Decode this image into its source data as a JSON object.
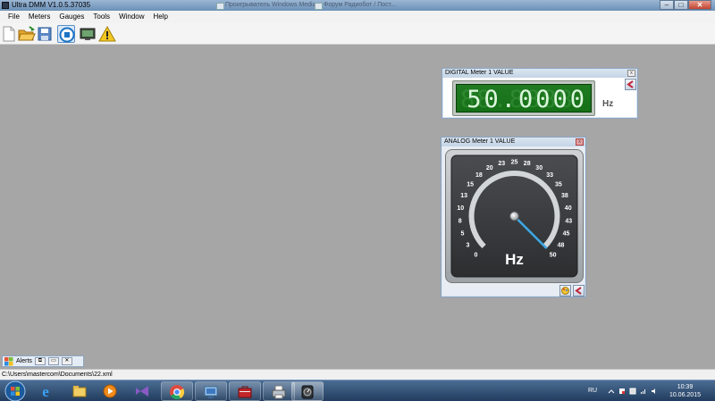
{
  "window": {
    "title": "Ultra DMM V1.0.5.37035",
    "background_tabs": [
      "Проигрыватель Windows Media",
      "Форум Радиобот / Пост..."
    ],
    "minimize_glyph": "–",
    "maximize_glyph": "□",
    "close_glyph": "✕"
  },
  "menu": [
    "File",
    "Meters",
    "Gauges",
    "Tools",
    "Window",
    "Help"
  ],
  "toolbar": {
    "buttons": [
      "new-file-icon",
      "open-folder-icon",
      "save-icon",
      "stop-icon",
      "monitor-icon",
      "warning-icon"
    ]
  },
  "digital_meter": {
    "title": "DIGITAL Meter 1 VALUE",
    "ghost_digits": "88.8888",
    "value": "50.0000",
    "unit": "Hz",
    "close_glyph": "x"
  },
  "analog_meter": {
    "title": "ANALOG Meter 1 VALUE",
    "unit": "Hz",
    "min": 0,
    "max": 50,
    "value": 50,
    "ticks": [
      "0",
      "3",
      "5",
      "8",
      "10",
      "13",
      "15",
      "18",
      "20",
      "23",
      "25",
      "28",
      "30",
      "33",
      "35",
      "38",
      "40",
      "43",
      "45",
      "48",
      "50"
    ],
    "close_glyph": "x"
  },
  "alerts_tab": {
    "label": "Alerts",
    "btn1": "⧉",
    "btn2": "▭",
    "btn3": "✕"
  },
  "statusbar": {
    "path": "C:\\Users\\mastercom\\Documents\\22.xml"
  },
  "taskbar": {
    "apps": [
      "ie-icon",
      "explorer-icon",
      "media-player-icon",
      "visual-studio-icon",
      "chrome-icon",
      "remote-desktop-icon",
      "briefcase-icon",
      "printer-icon",
      "meter-app-icon"
    ],
    "language": "RU",
    "time": "10:39",
    "date": "10.06.2015"
  },
  "colors": {
    "lcd_green": "#1f7a22",
    "needle": "#3da8e6",
    "mdi_background": "#a6a6a6"
  }
}
